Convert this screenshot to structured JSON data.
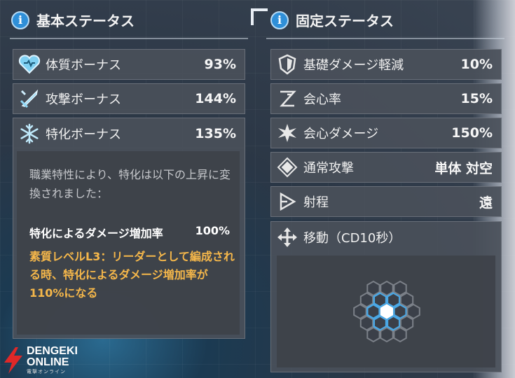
{
  "basic": {
    "title": "基本ステータス",
    "rows": [
      {
        "icon": "heart-icon",
        "label": "体質ボーナス",
        "value": "93%"
      },
      {
        "icon": "sword-icon",
        "label": "攻撃ボーナス",
        "value": "144%"
      },
      {
        "icon": "snowflake-icon",
        "label": "特化ボーナス",
        "value": "135%"
      }
    ],
    "detail": {
      "description": "職業特性により、特化は以下の上昇に変換されました：",
      "bonus_label": "特化によるダメージ増加率",
      "bonus_value": "100%",
      "talent": "素質レベルL3：リーダーとして編成される時、特化によるダメージ増加率が110%になる"
    }
  },
  "fixed": {
    "title": "固定ステータス",
    "rows": [
      {
        "icon": "shield-icon",
        "label": "基礎ダメージ軽減",
        "value": "10%"
      },
      {
        "icon": "crit-rate-icon",
        "label": "会心率",
        "value": "15%"
      },
      {
        "icon": "burst-icon",
        "label": "会心ダメージ",
        "value": "150%"
      },
      {
        "icon": "attack-pattern-icon",
        "label": "通常攻撃",
        "value": "単体 対空"
      },
      {
        "icon": "range-icon",
        "label": "射程",
        "value": "遠"
      }
    ],
    "movement": {
      "icon": "move-arrows-icon",
      "label": "移動（CD10秒）"
    }
  },
  "watermark": {
    "brand": "DENGEKI",
    "sub": "ONLINE",
    "caption": "電撃オンライン"
  },
  "colors": {
    "accent": "#2f8fd8",
    "talent": "#f5b74a",
    "hex_active": "#4aa8e6"
  }
}
